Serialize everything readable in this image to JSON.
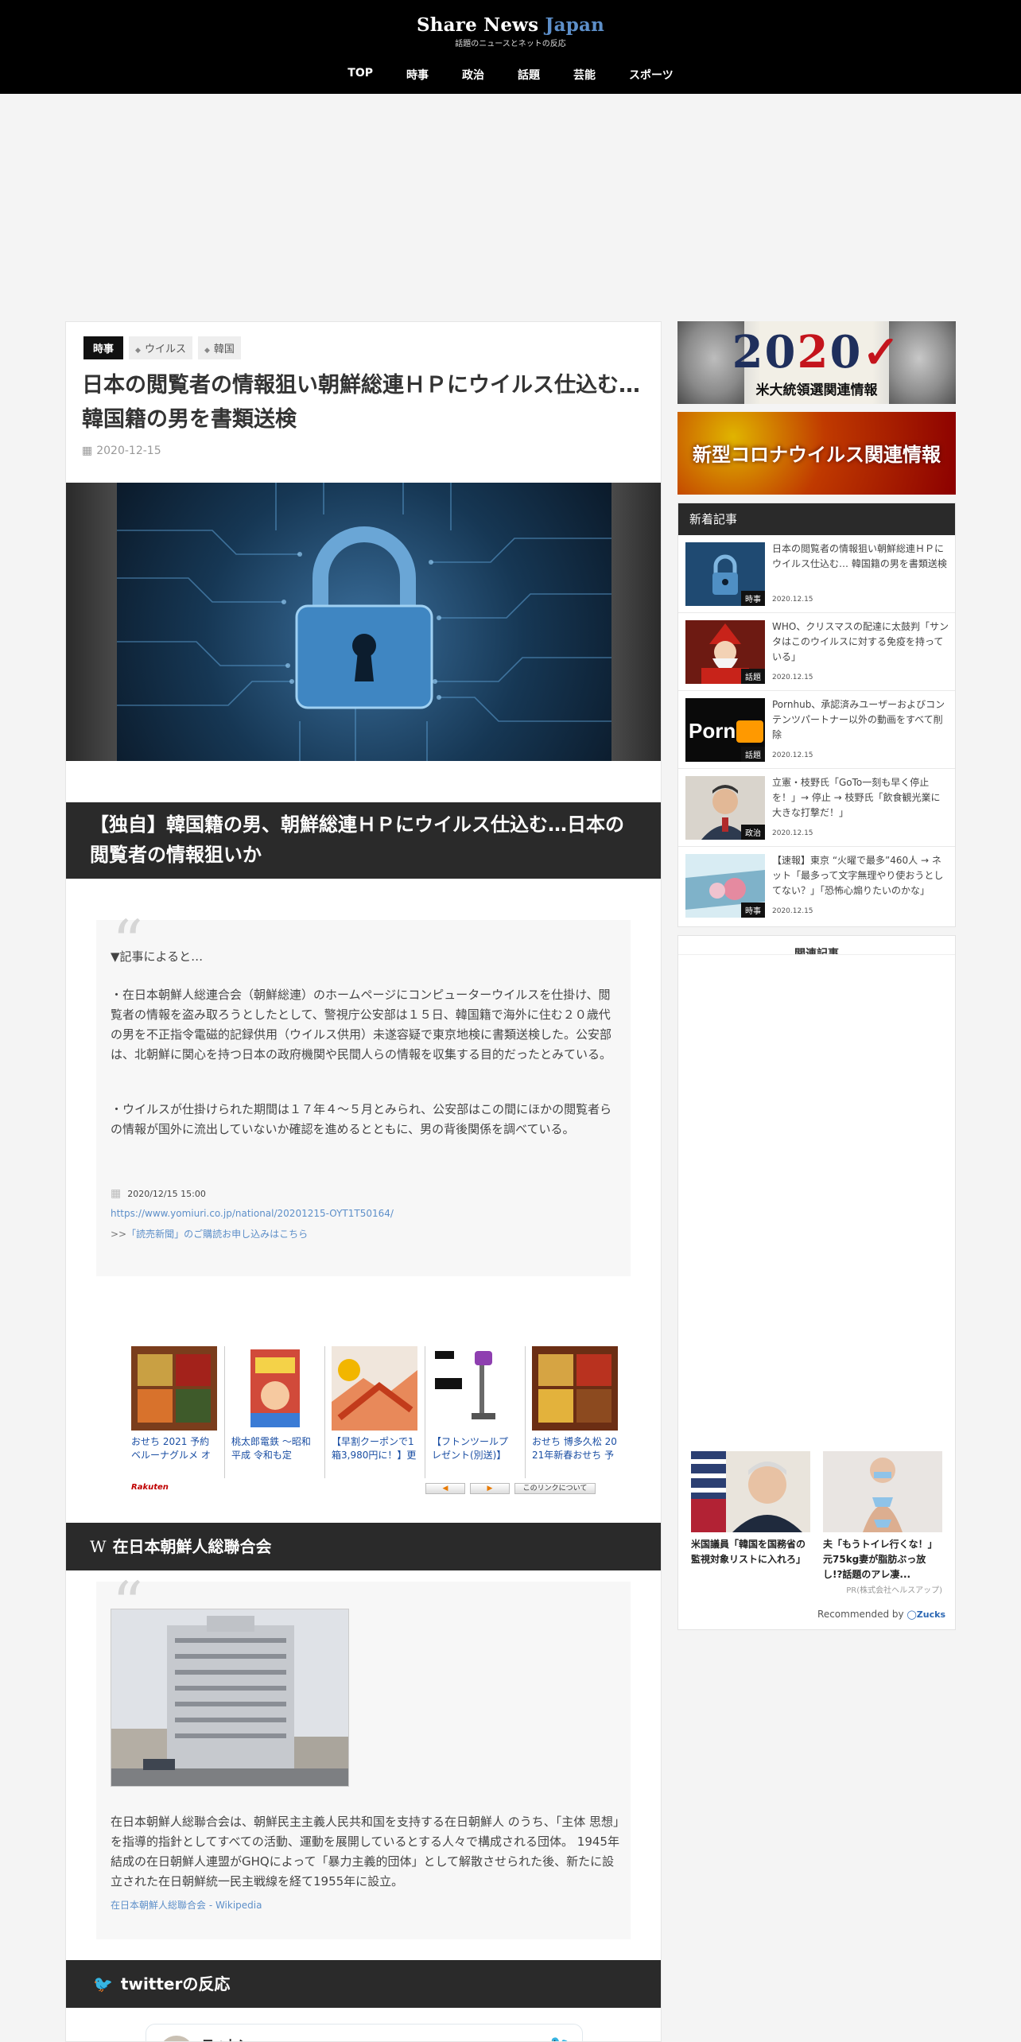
{
  "site": {
    "title_main": "Share News ",
    "title_accent": "Japan",
    "subtitle": "話題のニュースとネットの反応"
  },
  "nav": [
    {
      "label": "TOP"
    },
    {
      "label": "時事"
    },
    {
      "label": "政治"
    },
    {
      "label": "話題"
    },
    {
      "label": "芸能"
    },
    {
      "label": "スポーツ"
    }
  ],
  "article": {
    "category": "時事",
    "tags": [
      "ウイルス",
      "韓国"
    ],
    "title": "日本の閲覧者の情報狙い朝鮮総連ＨＰにウイルス仕込む… 韓国籍の男を書類送検",
    "date": "2020-12-15",
    "section1_heading": "【独自】韓国籍の男、朝鮮総連ＨＰにウイルス仕込む…日本の閲覧者の情報狙いか",
    "quote1": {
      "heading": "▼記事によると…",
      "para1": "・在日本朝鮮人総連合会（朝鮮総連）のホームページにコンピューターウイルスを仕掛け、閲覧者の情報を盗み取ろうとしたとして、警視庁公安部は１５日、韓国籍で海外に住む２０歳代の男を不正指令電磁的記録供用（ウイルス供用）未遂容疑で東京地検に書類送検した。公安部は、北朝鮮に関心を持つ日本の政府機関や民間人らの情報を収集する目的だったとみている。",
      "para2": "・ウイルスが仕掛けられた期間は１７年４～５月とみられ、公安部はこの間にほかの閲覧者らの情報が国外に流出していないか確認を進めるとともに、男の背後関係を調べている。",
      "date": "2020/12/15 15:00",
      "url": "https://www.yomiuri.co.jp/national/20201215-OYT1T50164/",
      "sub_prefix": ">>",
      "sub_link": "「読売新聞」のご購読お申し込みはこちら"
    },
    "section2_icon": "W",
    "section2_heading": "在日本朝鮮人総聯合会",
    "quote2": {
      "body": "在日本朝鮮人総聯合会は、朝鮮民主主義人民共和国を支持する在日朝鮮人 のうち、「主体 思想」を指導的指針としてすべての活動、運動を展開しているとする人々で構成される団体。 1945年結成の在日朝鮮人連盟がGHQによって「暴力主義的団体」として解散させられた後、新たに設立された在日朝鮮統一民主戦線を経て1955年に設立。",
      "link": "在日本朝鮮人総聯合会 - Wikipedia"
    },
    "section3_heading": "twitterの反応",
    "tweet": {
      "name": "フォトン"
    }
  },
  "rakuten": {
    "items": [
      {
        "title": "おせち 2021 予約 ベルーナグルメ オ",
        "color": "#7a3d1c"
      },
      {
        "title": "桃太郎電鉄 ～昭和 平成 令和も定",
        "color": "#d14a3a"
      },
      {
        "title": "【早割クーポンで1 箱3,980円に！】更",
        "color": "#e8895a"
      },
      {
        "title": "【フトンツールプ レゼント(別送)】",
        "color": "#e9e9e9"
      },
      {
        "title": "おせち 博多久松 20 21年新春おせち 予",
        "color": "#6b2e14"
      }
    ],
    "logo": "Rakuten",
    "prev": "◀",
    "next": "▶",
    "about": "このリンクについて"
  },
  "sidebar": {
    "banner1": {
      "year_a": "20",
      "year_b": "2",
      "year_c": "0",
      "label": "米大統領選関連情報"
    },
    "banner2": {
      "label": "新型コロナウイルス関連情報"
    },
    "new_heading": "新着記事",
    "new_items": [
      {
        "title": "日本の閲覧者の情報狙い朝鮮総連ＨＰにウイルス仕込む… 韓国籍の男を書類送検",
        "cat": "時事",
        "date": "2020.12.15",
        "color": "#1f4a72"
      },
      {
        "title": "WHO、クリスマスの配達に太鼓判「サンタはこのウイルスに対する免疫を持っている」",
        "cat": "話題",
        "date": "2020.12.15",
        "color": "#a8241a"
      },
      {
        "title": "Pornhub、承認済みユーザーおよびコンテンツパートナー以外の動画をすべて削除",
        "cat": "話題",
        "date": "2020.12.15",
        "color": "#111111"
      },
      {
        "title": "立憲・枝野氏「GoTo一刻も早く停止を！」→ 停止 → 枝野氏「飲食観光業に大きな打撃だ！」",
        "cat": "政治",
        "date": "2020.12.15",
        "color": "#5a4a3e"
      },
      {
        "title": "【速報】東京 “火曜で最多”460人 → ネット「最多って文字無理やり使おうとしてない？」「恐怖心煽りたいのかな」",
        "cat": "時事",
        "date": "2020.12.15",
        "color": "#7fb2c9"
      }
    ],
    "related_heading": "関連記事",
    "ads": [
      {
        "title": "米国議員「韓国を国務省の監視対象リストに入れろ」",
        "color": "#8b6f5e"
      },
      {
        "title": "夫「もうトイレ行くな！」元75kg妻が脂肪ぶっ放し!?話題のアレ凄...",
        "color": "#c9a58a"
      }
    ],
    "ad_sponsor": "PR(株式会社ヘルスアップ)",
    "recommended_by": "Recommended by",
    "recommended_brand": "Zucks"
  }
}
